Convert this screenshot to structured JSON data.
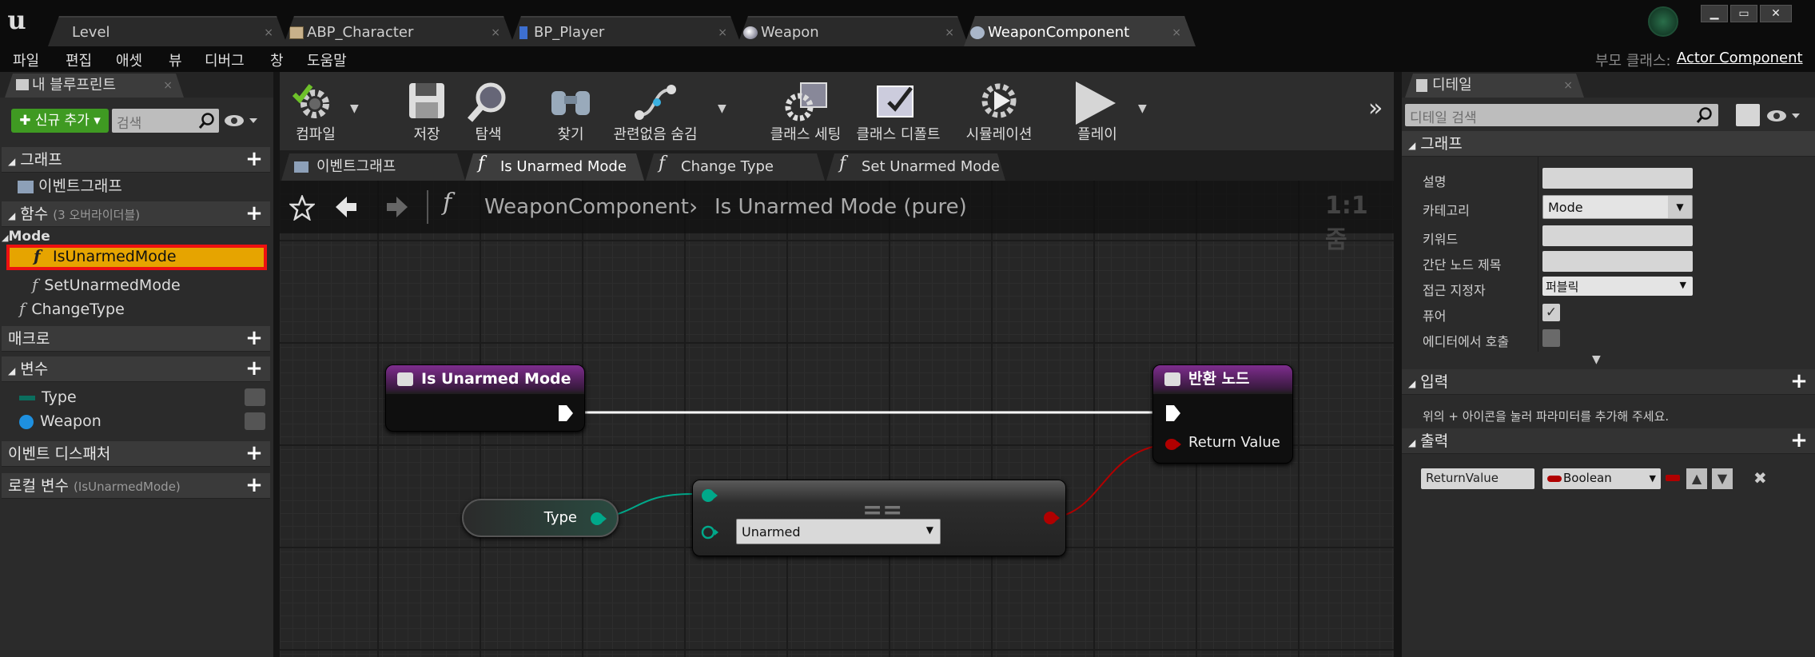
{
  "tabs": [
    {
      "label": "Level"
    },
    {
      "label": "ABP_Character"
    },
    {
      "label": "BP_Player"
    },
    {
      "label": "Weapon"
    },
    {
      "label": "WeaponComponent"
    }
  ],
  "tab_close": "×",
  "menu": [
    "파일",
    "편집",
    "애셋",
    "뷰",
    "디버그",
    "창",
    "도움말"
  ],
  "parent_class": {
    "label": "부모 클래스:",
    "value": "Actor Component"
  },
  "left_panel": {
    "tab": "내 블루프린트",
    "add_new": "✚ 신규 추가 ▾",
    "search_placeholder": "검색",
    "graphs_section": "그래프",
    "event_graph": "이벤트그래프",
    "functions_section": "함수",
    "functions_hint": "(3 오버라이더블)",
    "category": "Mode",
    "functions": [
      "IsUnarmedMode",
      "SetUnarmedMode",
      "ChangeType"
    ],
    "macros_section": "매크로",
    "variables_section": "변수",
    "variables": [
      "Type",
      "Weapon"
    ],
    "dispatchers_section": "이벤트 디스패처",
    "local_vars_section": "로컬 변수",
    "local_vars_hint": "(IsUnarmedMode)"
  },
  "toolbar": {
    "compile": "컴파일",
    "save": "저장",
    "browse": "탐색",
    "find": "찾기",
    "hide_unrelated": "관련없음 숨김",
    "class_settings": "클래스 세팅",
    "class_defaults": "클래스 디폴트",
    "simulation": "시뮬레이션",
    "play": "플레이"
  },
  "graph_tabs": [
    "이벤트그래프",
    "Is Unarmed Mode",
    "Change Type",
    "Set Unarmed Mode"
  ],
  "graph": {
    "breadcrumb_root": "WeaponComponent",
    "breadcrumb_sep": "›",
    "breadcrumb_current": "Is Unarmed Mode (pure)",
    "zoom": "1:1 줌",
    "entry_node_title": "Is Unarmed Mode",
    "return_node_title": "반환 노드",
    "return_pin": "Return Value",
    "type_node_label": "Type",
    "equal_symbol": "==",
    "enum_value": "Unarmed",
    "colors": {
      "exec": "#ffffff",
      "bool": "#b00000",
      "enum": "#00a88a",
      "function": "#7e2d8e"
    }
  },
  "details": {
    "tab": "디테일",
    "search_placeholder": "디테일 검색",
    "graph_section": "그래프",
    "rows": [
      {
        "label": "설명",
        "value": ""
      },
      {
        "label": "카테고리",
        "value": "Mode"
      },
      {
        "label": "키워드",
        "value": ""
      },
      {
        "label": "간단 노드 제목",
        "value": ""
      },
      {
        "label": "접근 지정자",
        "value": "퍼블릭"
      },
      {
        "label": "퓨어",
        "value": "✓"
      },
      {
        "label": "에디터에서 호출",
        "value": ""
      }
    ],
    "inputs_section": "입력",
    "inputs_hint": "위의 + 아이콘을 눌러 파라미터를 추가해 주세요.",
    "outputs_section": "출력",
    "output_name": "ReturnValue",
    "output_type": "Boolean"
  }
}
